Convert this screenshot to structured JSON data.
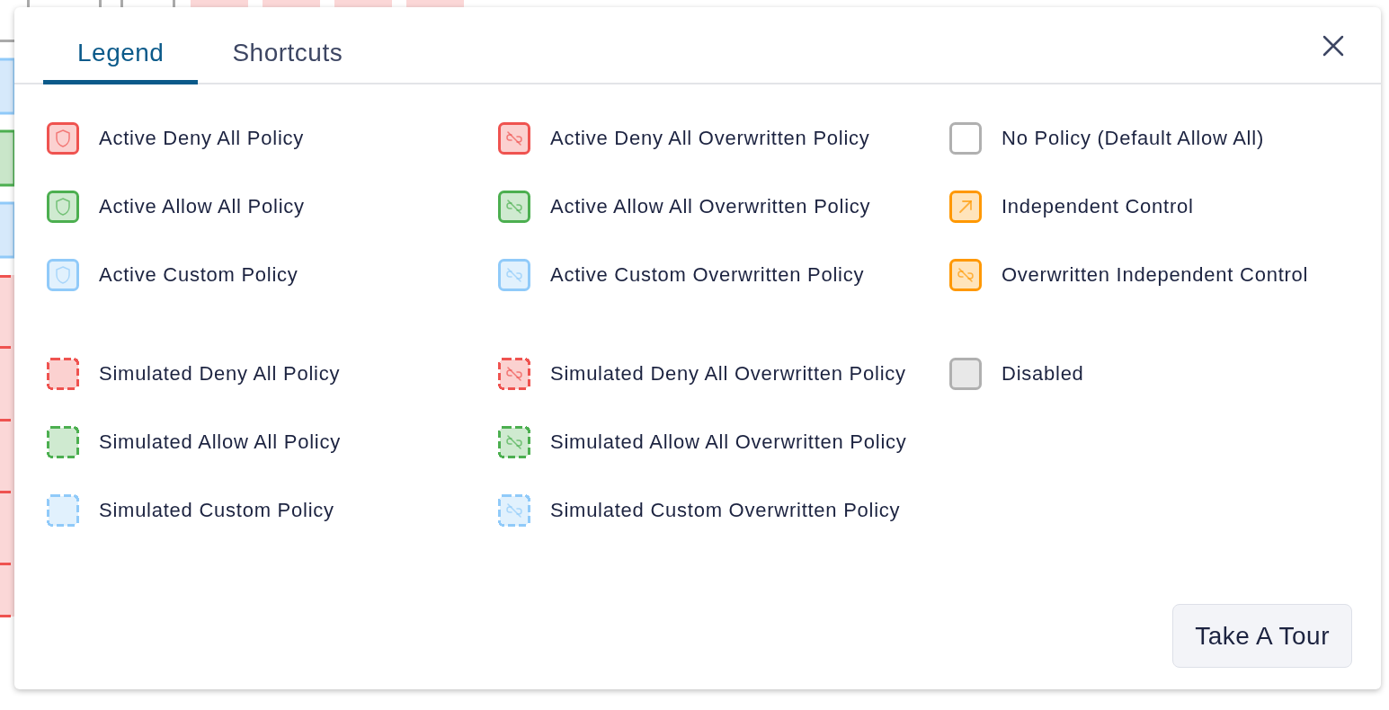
{
  "tabs": [
    {
      "label": "Legend",
      "selected": true
    },
    {
      "label": "Shortcuts",
      "selected": false
    }
  ],
  "legend": {
    "columns": [
      {
        "groups": [
          [
            {
              "label": "Active Deny All Policy",
              "kind": "active",
              "color": "#ef5350"
            },
            {
              "label": "Active Allow All Policy",
              "kind": "active",
              "color": "#4caf50"
            },
            {
              "label": "Active Custom Policy",
              "kind": "active",
              "color": "#90caf9"
            }
          ],
          [
            {
              "label": "Simulated Deny All Policy",
              "kind": "simulated",
              "color": "#ef5350"
            },
            {
              "label": "Simulated Allow All Policy",
              "kind": "simulated",
              "color": "#4caf50"
            },
            {
              "label": "Simulated Custom Policy",
              "kind": "simulated",
              "color": "#90caf9"
            }
          ]
        ]
      },
      {
        "groups": [
          [
            {
              "label": "Active Deny All Overwritten Policy",
              "kind": "activeOverwritten",
              "color": "#ef5350"
            },
            {
              "label": "Active Allow All Overwritten Policy",
              "kind": "activeOverwritten",
              "color": "#4caf50"
            },
            {
              "label": "Active Custom Overwritten Policy",
              "kind": "activeOverwritten",
              "color": "#90caf9"
            }
          ],
          [
            {
              "label": "Simulated Deny All Overwritten Policy",
              "kind": "simulatedOverwritten",
              "color": "#ef5350"
            },
            {
              "label": "Simulated Allow All Overwritten Policy",
              "kind": "simulatedOverwritten",
              "color": "#4caf50"
            },
            {
              "label": "Simulated Custom Overwritten Policy",
              "kind": "simulatedOverwritten",
              "color": "#90caf9"
            }
          ]
        ]
      },
      {
        "groups": [
          [
            {
              "label": "No Policy (Default Allow All)",
              "kind": "empty",
              "color": "#b0b0b0"
            },
            {
              "label": "Independent Control",
              "kind": "independent",
              "color": "#ff9800"
            },
            {
              "label": "Overwritten Independent Control",
              "kind": "activeOverwritten",
              "color": "#ff9800"
            }
          ],
          [
            {
              "label": "Disabled",
              "kind": "disabled",
              "color": "#b0b0b0"
            }
          ]
        ]
      }
    ]
  },
  "tour_button": "Take A Tour"
}
